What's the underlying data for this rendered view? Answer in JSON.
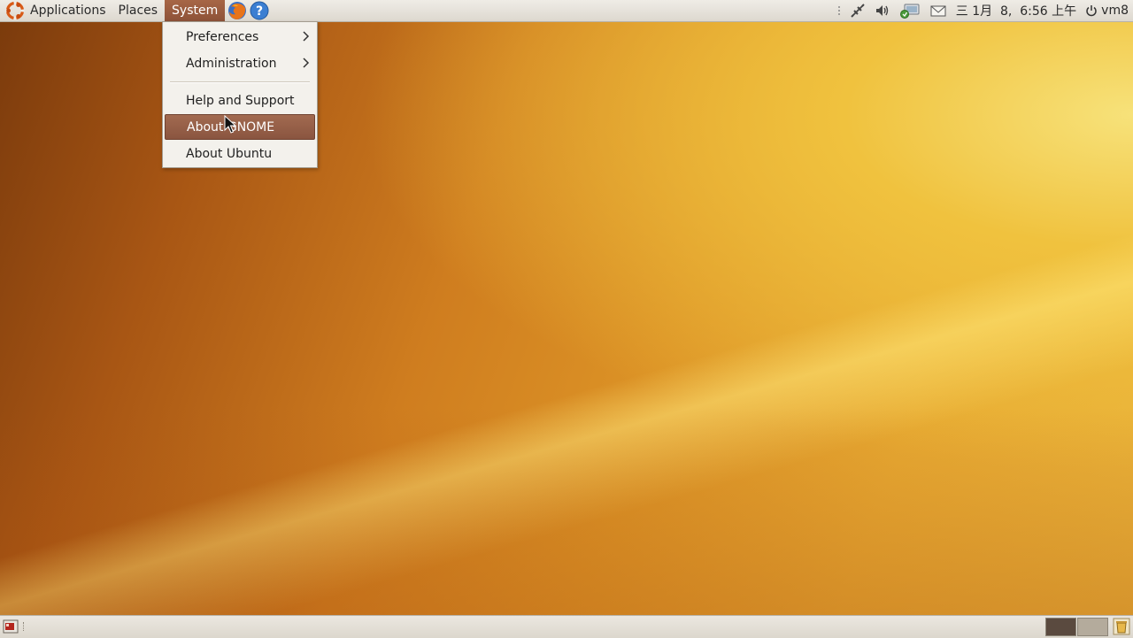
{
  "top_panel": {
    "menus": {
      "applications": "Applications",
      "places": "Places",
      "system": "System"
    },
    "launchers": [
      "firefox-icon",
      "help-icon"
    ],
    "tray": {
      "datetime": "三 1月  8,  6:56 上午",
      "user": "vm8"
    }
  },
  "system_menu": {
    "items": [
      {
        "label": "Preferences",
        "submenu": true
      },
      {
        "label": "Administration",
        "submenu": true
      },
      {
        "label": "Help and Support",
        "submenu": false
      },
      {
        "label": "About GNOME",
        "submenu": false,
        "highlighted": true
      },
      {
        "label": "About Ubuntu",
        "submenu": false
      }
    ]
  },
  "bottom_panel": {
    "workspaces": 2,
    "current_workspace": 1
  },
  "colors": {
    "panel": "#dedad2",
    "menu_highlight": "#9a6048",
    "wallpaper_dark": "#7a3a0c",
    "wallpaper_light": "#f3d56a"
  }
}
